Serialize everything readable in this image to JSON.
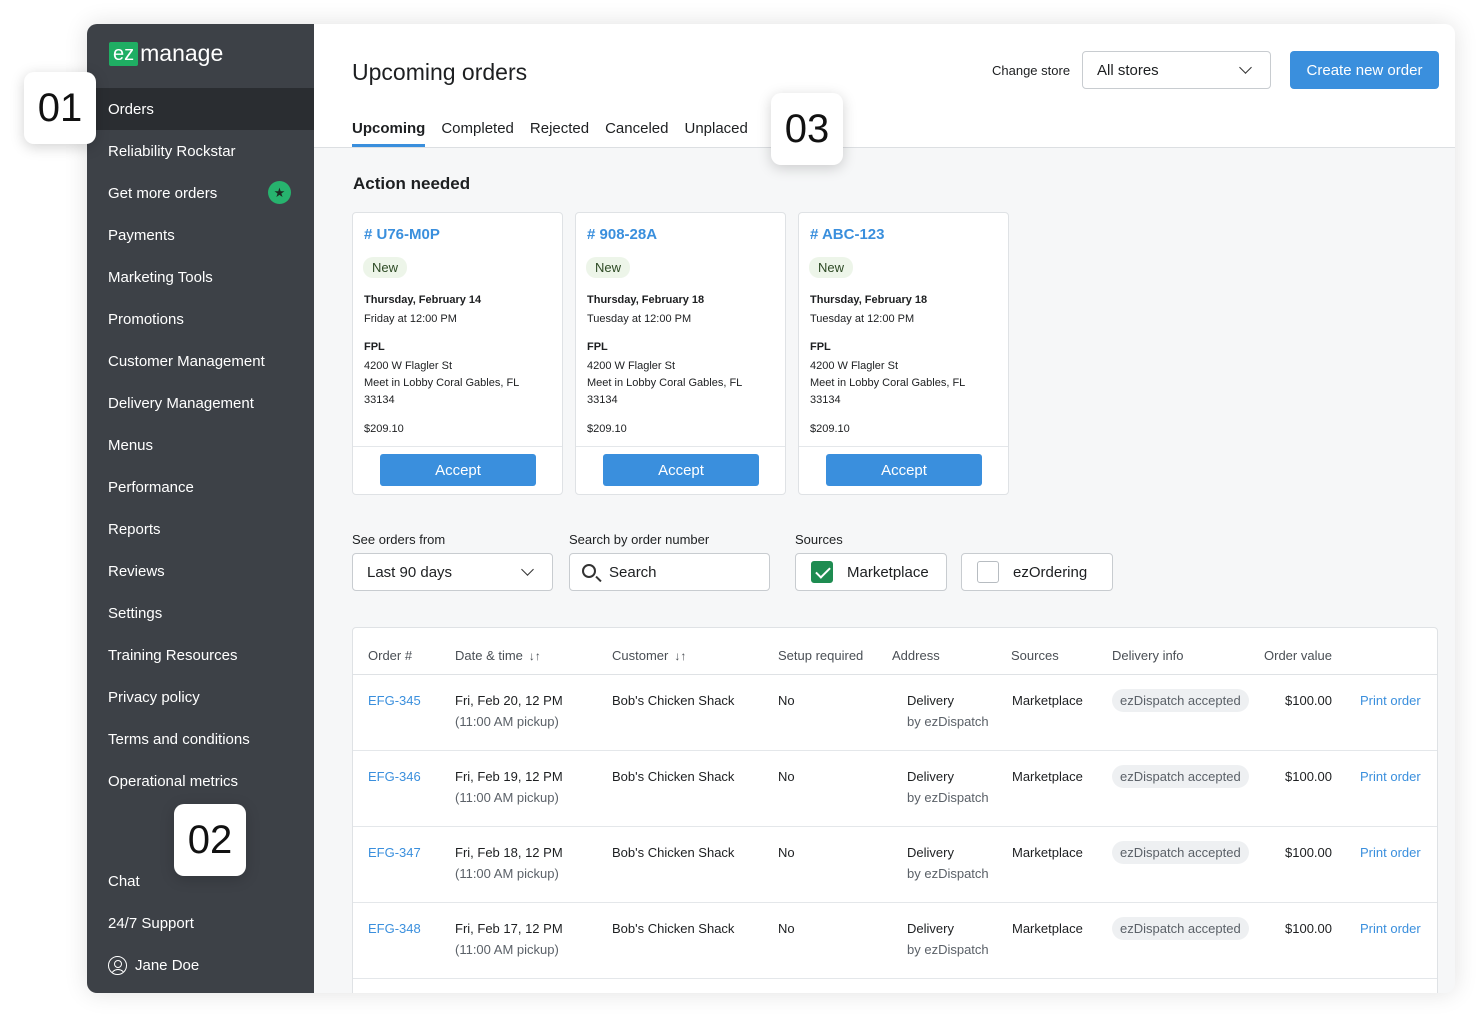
{
  "brand": {
    "logo_ez": "ez",
    "logo_manage": "manage",
    "accent": "#3a8fdd",
    "sidebar_bg": "#3d4147"
  },
  "sidebar": {
    "items": [
      {
        "label": "Orders"
      },
      {
        "label": "Reliability Rockstar"
      },
      {
        "label": "Get more orders"
      },
      {
        "label": "Payments"
      },
      {
        "label": "Marketing Tools"
      },
      {
        "label": "Promotions"
      },
      {
        "label": "Customer Management"
      },
      {
        "label": "Delivery Management"
      },
      {
        "label": "Menus"
      },
      {
        "label": "Performance"
      },
      {
        "label": "Reports"
      },
      {
        "label": "Reviews"
      },
      {
        "label": "Settings"
      },
      {
        "label": "Training Resources"
      },
      {
        "label": "Privacy policy"
      },
      {
        "label": "Terms and conditions"
      },
      {
        "label": "Operational metrics"
      }
    ],
    "chat": "Chat",
    "support": "24/7 Support",
    "user": "Jane Doe"
  },
  "header": {
    "title": "Upcoming orders",
    "change_store_label": "Change store",
    "store_value": "All stores",
    "create_button": "Create new order",
    "tabs": [
      {
        "label": "Upcoming"
      },
      {
        "label": "Completed"
      },
      {
        "label": "Rejected"
      },
      {
        "label": "Canceled"
      },
      {
        "label": "Unplaced"
      }
    ]
  },
  "action_needed": {
    "title": "Action needed",
    "cards": [
      {
        "id": "# U76-M0P",
        "status": "New",
        "date": "Thursday, February 14",
        "time": "Friday at 12:00 PM",
        "company": "FPL",
        "addr1": "4200 W Flagler St",
        "addr2": "Meet in Lobby Coral Gables, FL",
        "zip": "33134",
        "total": "$209.10",
        "button": "Accept"
      },
      {
        "id": "# 908-28A",
        "status": "New",
        "date": "Thursday, February 18",
        "time": "Tuesday at 12:00 PM",
        "company": "FPL",
        "addr1": "4200 W Flagler St",
        "addr2": "Meet in Lobby Coral Gables, FL",
        "zip": "33134",
        "total": "$209.10",
        "button": "Accept"
      },
      {
        "id": "# ABC-123",
        "status": "New",
        "date": "Thursday, February 18",
        "time": "Tuesday at 12:00 PM",
        "company": "FPL",
        "addr1": "4200 W Flagler St",
        "addr2": "Meet in Lobby Coral Gables, FL",
        "zip": "33134",
        "total": "$209.10",
        "button": "Accept"
      }
    ]
  },
  "filters": {
    "orders_from_label": "See orders from",
    "orders_from_value": "Last 90 days",
    "search_label": "Search by order number",
    "search_placeholder": "Search",
    "sources_label": "Sources",
    "sources": [
      {
        "label": "Marketplace",
        "checked": true
      },
      {
        "label": "ezOrdering",
        "checked": false
      }
    ]
  },
  "table": {
    "headers": {
      "order": "Order #",
      "datetime": "Date & time",
      "customer": "Customer",
      "setup": "Setup required",
      "address": "Address",
      "sources": "Sources",
      "delivery": "Delivery info",
      "value": "Order value",
      "sort_glyph": "↓↑"
    },
    "rows": [
      {
        "order": "EFG-345",
        "date": "Fri, Feb 20, 12 PM",
        "pickup": "(11:00 AM pickup)",
        "customer": "Bob's Chicken Shack",
        "setup": "No",
        "address": "Delivery",
        "address_sub": "by ezDispatch",
        "source": "Marketplace",
        "delivery": "ezDispatch accepted",
        "value": "$100.00",
        "action": "Print order"
      },
      {
        "order": "EFG-346",
        "date": "Fri, Feb 19, 12 PM",
        "pickup": "(11:00 AM pickup)",
        "customer": "Bob's Chicken Shack",
        "setup": "No",
        "address": "Delivery",
        "address_sub": "by ezDispatch",
        "source": "Marketplace",
        "delivery": "ezDispatch accepted",
        "value": "$100.00",
        "action": "Print order"
      },
      {
        "order": "EFG-347",
        "date": "Fri, Feb 18, 12 PM",
        "pickup": "(11:00 AM pickup)",
        "customer": "Bob's Chicken Shack",
        "setup": "No",
        "address": "Delivery",
        "address_sub": "by ezDispatch",
        "source": "Marketplace",
        "delivery": "ezDispatch accepted",
        "value": "$100.00",
        "action": "Print order"
      },
      {
        "order": "EFG-348",
        "date": "Fri, Feb 17, 12 PM",
        "pickup": "(11:00 AM pickup)",
        "customer": "Bob's Chicken Shack",
        "setup": "No",
        "address": "Delivery",
        "address_sub": "by ezDispatch",
        "source": "Marketplace",
        "delivery": "ezDispatch accepted",
        "value": "$100.00",
        "action": "Print order"
      }
    ]
  },
  "callouts": {
    "c1": "01",
    "c2": "02",
    "c3": "03"
  }
}
